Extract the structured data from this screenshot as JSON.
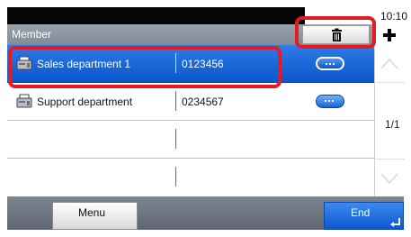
{
  "status": {
    "time": "10:10"
  },
  "header": {
    "title": "Member"
  },
  "toolbar": {
    "delete_icon": "trash-icon",
    "add_icon": "plus-icon"
  },
  "rows": [
    {
      "name": "Sales department 1",
      "number": "0123456",
      "selected": true
    },
    {
      "name": "Support department",
      "number": "0234567",
      "selected": false
    },
    {
      "name": "",
      "number": "",
      "selected": false
    },
    {
      "name": "",
      "number": "",
      "selected": false
    }
  ],
  "pagination": {
    "label": "1/1"
  },
  "footer": {
    "menu_label": "Menu",
    "end_label": "End"
  },
  "colors": {
    "accent": "#1a66dc",
    "highlight": "#e41b23"
  }
}
